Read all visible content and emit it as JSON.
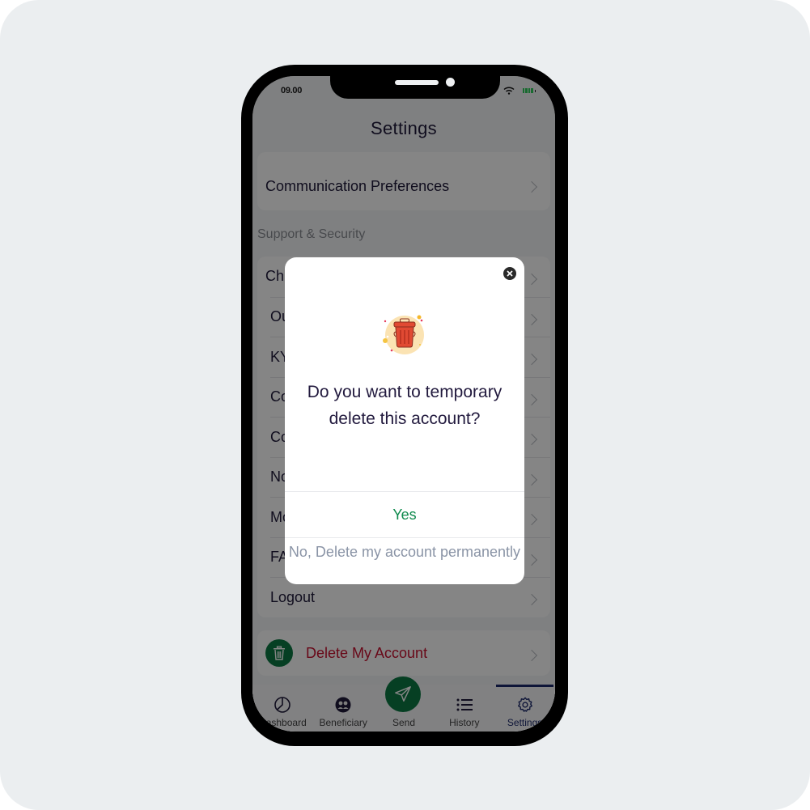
{
  "status_bar": {
    "time": "09.00",
    "wifi_icon": "wifi-icon",
    "battery_icon": "battery-icon"
  },
  "header": {
    "title": "Settings"
  },
  "settings": {
    "top_card_items": [
      {
        "label": "Communication Preferences"
      }
    ],
    "section_support": {
      "title": "Support & Security",
      "items": [
        {
          "label": "Ch"
        },
        {
          "label": "Ou"
        },
        {
          "label": "KY"
        },
        {
          "label": "Co"
        },
        {
          "label": "Co"
        },
        {
          "label": "No"
        },
        {
          "label": "Mo"
        },
        {
          "label": "FA"
        },
        {
          "label": "Logout"
        }
      ]
    },
    "delete_account": {
      "label": "Delete My Account",
      "icon": "trash-icon",
      "color": "#c8102e"
    }
  },
  "tabbar": {
    "items": [
      {
        "label": "Dashboard",
        "icon": "pie-chart-icon"
      },
      {
        "label": "Beneficiary",
        "icon": "users-icon"
      },
      {
        "label": "Send",
        "icon": "send-icon"
      },
      {
        "label": "History",
        "icon": "list-icon"
      },
      {
        "label": "Settings",
        "icon": "gear-icon",
        "active": true
      }
    ]
  },
  "modal": {
    "close_icon": "close-icon",
    "illustration": "trash-can-illustration",
    "title": "Do you want to temporary delete this account?",
    "yes_label": "Yes",
    "no_label": "No, Delete my account permanently",
    "colors": {
      "yes": "#0f8a4d",
      "no": "#8a94a6"
    }
  },
  "colors": {
    "brand_green": "#0c7a43",
    "active_tab": "#1c2a6b"
  }
}
